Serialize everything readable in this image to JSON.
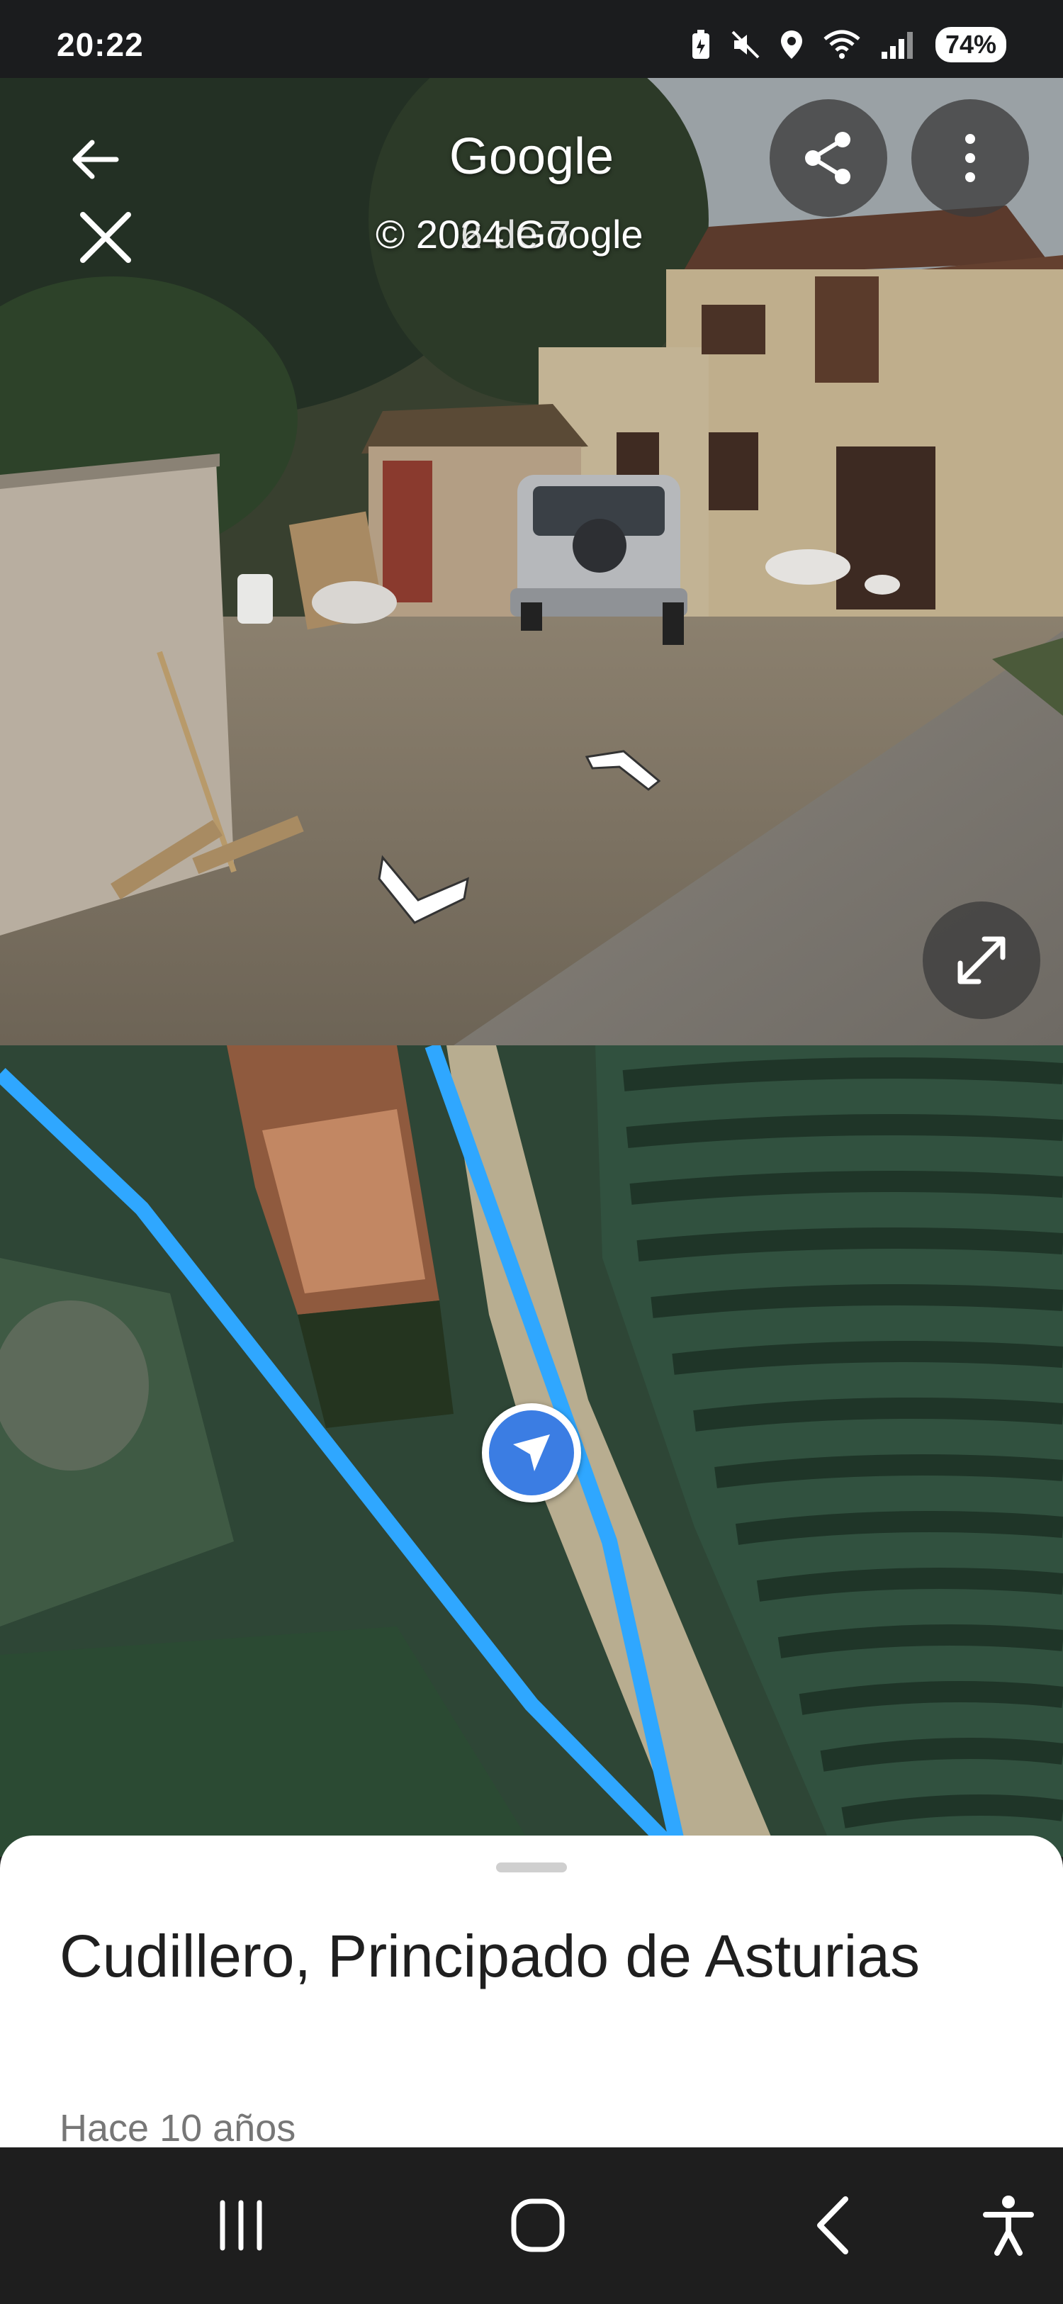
{
  "status_bar": {
    "time": "20:22",
    "battery": "74%",
    "icons": [
      "battery-saver-icon",
      "mute-icon",
      "location-icon",
      "wifi-icon",
      "signal-icon"
    ]
  },
  "street_view": {
    "title": "Google",
    "copyright": "© 2024 Google",
    "photo_counter": "6 de 7",
    "buttons": {
      "back": "back-arrow-icon",
      "close": "close-icon",
      "share": "share-icon",
      "more": "more-vert-icon",
      "expand": "expand-icon"
    }
  },
  "map": {
    "location_marker": "navigation-arrow-icon",
    "route_color": "#2fa7ff"
  },
  "place_sheet": {
    "title": "Cudillero, Principado de Asturias",
    "subtitle": "Hace 10 años"
  },
  "nav_bar": {
    "buttons": [
      "recents-icon",
      "home-icon",
      "back-icon",
      "accessibility-icon"
    ]
  }
}
